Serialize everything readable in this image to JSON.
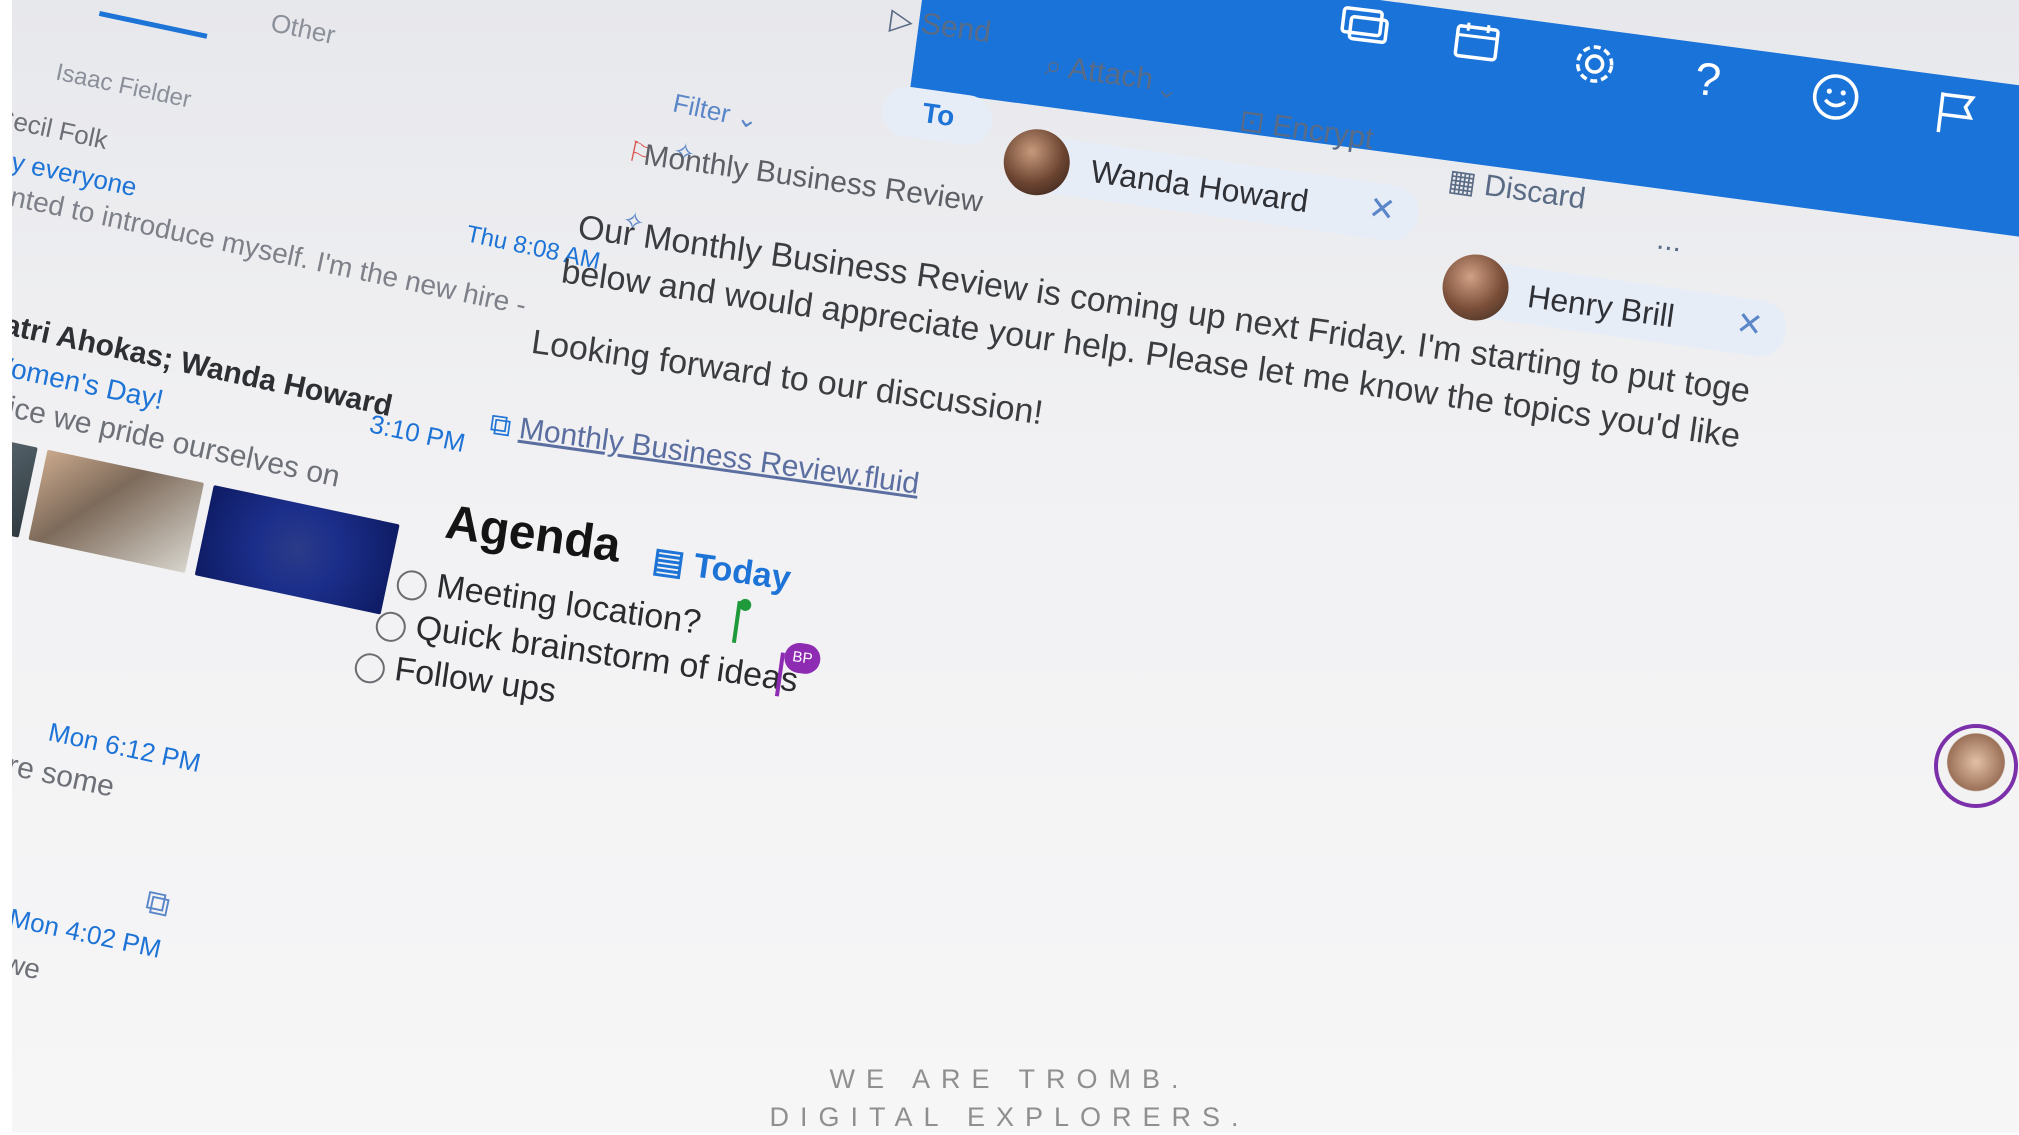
{
  "mail_list": {
    "tabs": {
      "focused": "",
      "other": "Other"
    },
    "filter_label": "Filter",
    "items": [
      {
        "sender": "Isaac Fielder"
      },
      {
        "sender": "Cecil Folk",
        "subject": "Hey everyone",
        "preview": "I wanted to introduce myself. I'm the new hire -",
        "time": "Thu 8:08 AM"
      },
      {
        "sender": "Katri Ahokas; Wanda Howard",
        "subject": "Women's Day!",
        "preview": "office we pride ourselves on",
        "time": "3:10 PM"
      },
      {
        "time": "Mon 6:12 PM",
        "preview": "are some"
      },
      {
        "time": "Mon 4:02 PM",
        "preview": "we"
      }
    ]
  },
  "compose": {
    "toolbar": {
      "send": "Send",
      "attach": "Attach",
      "encrypt": "Encrypt",
      "discard": "Discard",
      "more": "..."
    },
    "to_label": "To",
    "recipients": [
      {
        "name": "Wanda Howard"
      },
      {
        "name": "Henry Brill"
      }
    ],
    "subject": "Monthly Business Review",
    "body_line1": "Our Monthly Business Review is coming up next Friday. I'm starting to put toge",
    "body_line2": "below and would appreciate your help. Please let me know the topics you'd like",
    "body_line3": "Looking forward to our discussion!",
    "attachment": "Monthly Business Review.fluid",
    "agenda": {
      "title": "Agenda",
      "date_label": "Today",
      "tasks": [
        {
          "label": "Meeting location?"
        },
        {
          "label": "Quick brainstorm of ideas"
        },
        {
          "label": "Follow ups"
        }
      ],
      "cursor_initials": "BP"
    }
  },
  "header_icons": [
    "chat-icon",
    "calendar-icon",
    "settings-icon",
    "help-icon",
    "smiley-icon",
    "flag-icon"
  ],
  "watermark": {
    "line1": "WE ARE TROMB.",
    "line2": "DIGITAL EXPLORERS."
  },
  "colors": {
    "accent": "#1a73d9",
    "link": "#1d73d6",
    "cursor_green": "#1f9a3a",
    "cursor_purple": "#8e2bb3"
  }
}
